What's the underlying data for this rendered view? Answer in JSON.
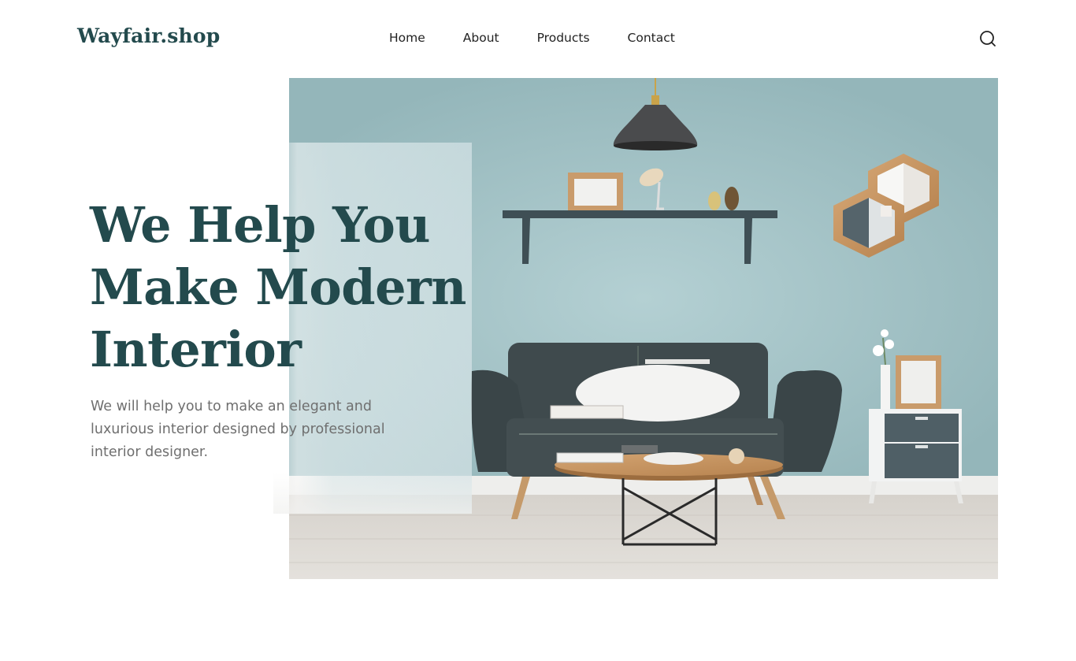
{
  "header": {
    "logo": "Wayfair.shop",
    "nav": [
      "Home",
      "About",
      "Products",
      "Contact"
    ],
    "search_icon": "search-icon"
  },
  "hero": {
    "headline_lines": [
      "We Help You",
      "Make Modern",
      "Interior"
    ],
    "subtext": "We will help you to make an elegant and luxurious interior designed by professional interior designer.",
    "image": "living-room-photo"
  },
  "colors": {
    "brand": "#234a4d",
    "wall": "#9cbcc0",
    "sofa": "#3f4a4d",
    "floor": "#d8d4cf",
    "body_text": "#6f6f6f"
  }
}
